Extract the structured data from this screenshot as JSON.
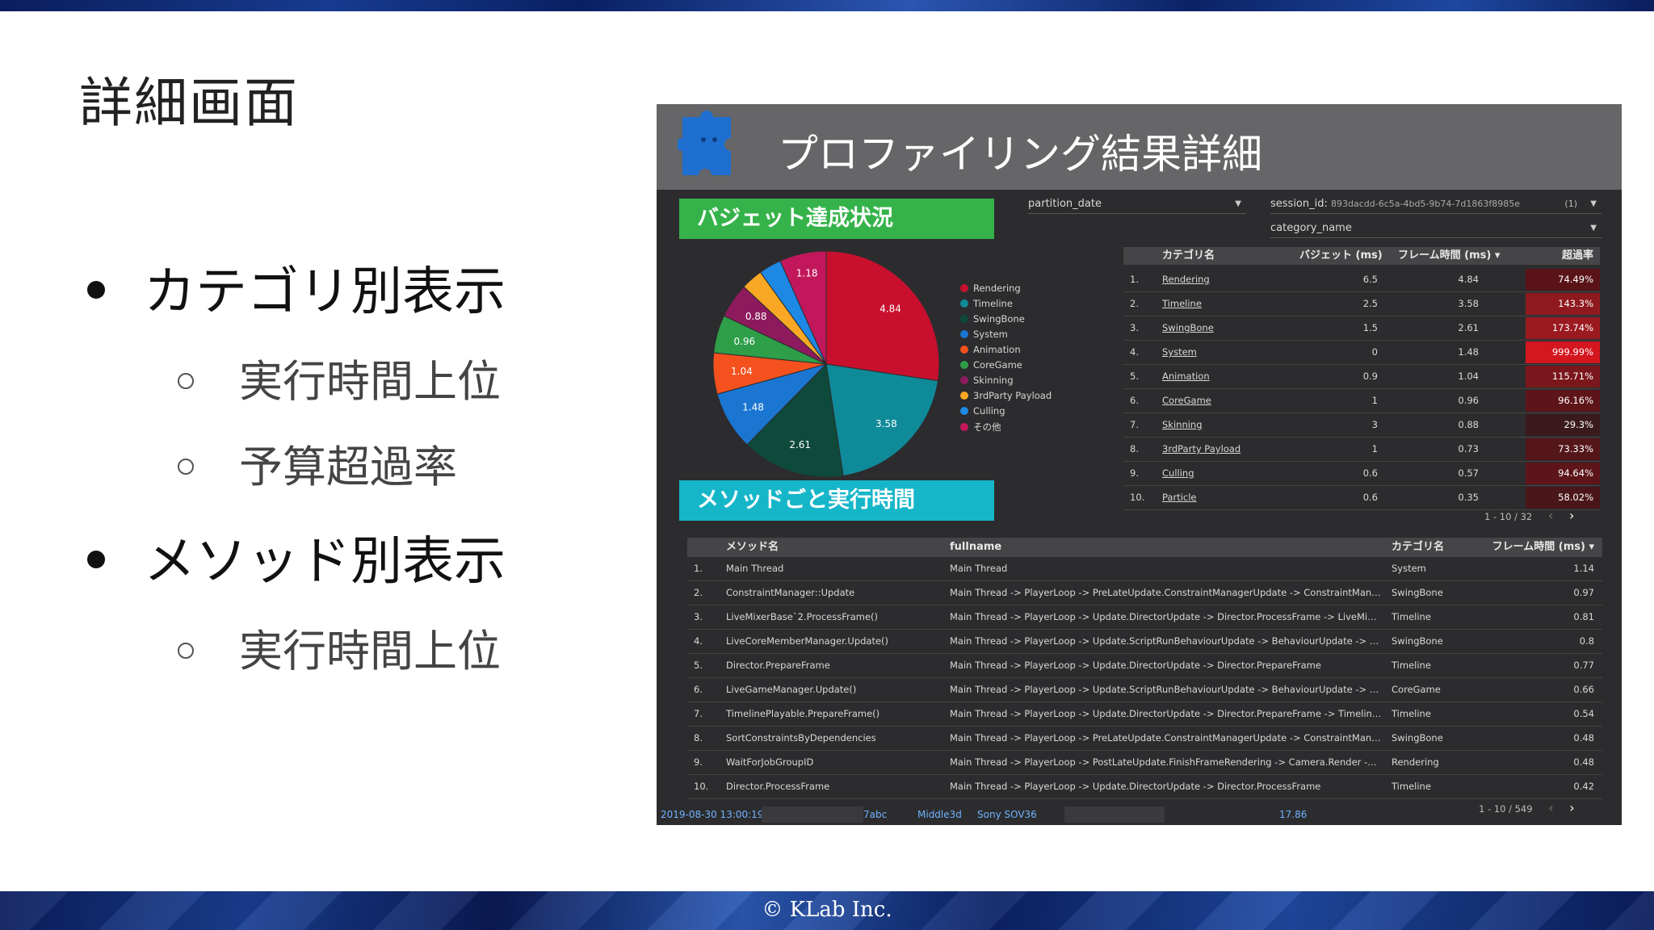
{
  "slide": {
    "title": "詳細画面",
    "bullets": [
      {
        "text": "カテゴリ別表示",
        "sub": [
          "実行時間上位",
          "予算超過率"
        ]
      },
      {
        "text": "メソッド別表示",
        "sub": [
          "実行時間上位"
        ]
      }
    ],
    "copyright": "© KLab Inc."
  },
  "dashboard": {
    "title": "プロファイリング結果詳細",
    "budget_banner": "バジェット達成状況",
    "method_banner": "メソッドごと実行時間",
    "filters": {
      "partition_date": "partition_date",
      "session_label": "session_id:",
      "session_value": "893dacdd-6c5a-4bd5-9b74-7d1863f8985e",
      "session_count": "(1)",
      "category_name": "category_name"
    },
    "category_table": {
      "headers": [
        "カテゴリ名",
        "バジェット (ms)",
        "フレーム時間 (ms) ▾",
        "超過率"
      ],
      "rows": [
        {
          "n": "1.",
          "name": "Rendering",
          "budget": "6.5",
          "frame": "4.84",
          "rate": "74.49%"
        },
        {
          "n": "2.",
          "name": "Timeline",
          "budget": "2.5",
          "frame": "3.58",
          "rate": "143.3%"
        },
        {
          "n": "3.",
          "name": "SwingBone",
          "budget": "1.5",
          "frame": "2.61",
          "rate": "173.74%"
        },
        {
          "n": "4.",
          "name": "System",
          "budget": "0",
          "frame": "1.48",
          "rate": "999.99%"
        },
        {
          "n": "5.",
          "name": "Animation",
          "budget": "0.9",
          "frame": "1.04",
          "rate": "115.71%"
        },
        {
          "n": "6.",
          "name": "CoreGame",
          "budget": "1",
          "frame": "0.96",
          "rate": "96.16%"
        },
        {
          "n": "7.",
          "name": "Skinning",
          "budget": "3",
          "frame": "0.88",
          "rate": "29.3%"
        },
        {
          "n": "8.",
          "name": "3rdParty Payload",
          "budget": "1",
          "frame": "0.73",
          "rate": "73.33%"
        },
        {
          "n": "9.",
          "name": "Culling",
          "budget": "0.6",
          "frame": "0.57",
          "rate": "94.64%"
        },
        {
          "n": "10.",
          "name": "Particle",
          "budget": "0.6",
          "frame": "0.35",
          "rate": "58.02%"
        }
      ],
      "rate_colors": [
        "#5a1418",
        "#8e1a1f",
        "#9b1a20",
        "#d4161f",
        "#7a171c",
        "#5e1519",
        "#3a1a1c",
        "#541619",
        "#5d1519",
        "#4a1619"
      ],
      "pager": "1 - 10 / 32"
    },
    "method_table": {
      "headers": [
        "メソッド名",
        "fullname",
        "カテゴリ名",
        "フレーム時間 (ms) ▾"
      ],
      "rows": [
        {
          "n": "1.",
          "method": "Main Thread",
          "full": "Main Thread",
          "cat": "System",
          "ms": "1.14"
        },
        {
          "n": "2.",
          "method": "ConstraintManager::Update",
          "full": "Main Thread -> PlayerLoop -> PreLateUpdate.ConstraintManagerUpdate -> ConstraintManager::Up...",
          "cat": "SwingBone",
          "ms": "0.97"
        },
        {
          "n": "3.",
          "method": "LiveMixerBase`2.ProcessFrame()",
          "full": "Main Thread -> PlayerLoop -> Update.DirectorUpdate -> Director.ProcessFrame -> LiveMixerBase`2....",
          "cat": "Timeline",
          "ms": "0.81"
        },
        {
          "n": "4.",
          "method": "LiveCoreMemberManager.Update()",
          "full": "Main Thread -> PlayerLoop -> Update.ScriptRunBehaviourUpdate -> BehaviourUpdate -> LiveCoreM...",
          "cat": "SwingBone",
          "ms": "0.8"
        },
        {
          "n": "5.",
          "method": "Director.PrepareFrame",
          "full": "Main Thread -> PlayerLoop -> Update.DirectorUpdate -> Director.PrepareFrame",
          "cat": "Timeline",
          "ms": "0.77"
        },
        {
          "n": "6.",
          "method": "LiveGameManager.Update()",
          "full": "Main Thread -> PlayerLoop -> Update.ScriptRunBehaviourUpdate -> BehaviourUpdate -> LiveGame...",
          "cat": "CoreGame",
          "ms": "0.66"
        },
        {
          "n": "7.",
          "method": "TimelinePlayable.PrepareFrame()",
          "full": "Main Thread -> PlayerLoop -> Update.DirectorUpdate -> Director.PrepareFrame -> TimelinePlayable...",
          "cat": "Timeline",
          "ms": "0.54"
        },
        {
          "n": "8.",
          "method": "SortConstraintsByDependencies",
          "full": "Main Thread -> PlayerLoop -> PreLateUpdate.ConstraintManagerUpdate -> ConstraintManager::Up...",
          "cat": "SwingBone",
          "ms": "0.48"
        },
        {
          "n": "9.",
          "method": "WaitForJobGroupID",
          "full": "Main Thread -> PlayerLoop -> PostLateUpdate.FinishFrameRendering -> Camera.Render -> Culling -...",
          "cat": "Rendering",
          "ms": "0.48"
        },
        {
          "n": "10.",
          "method": "Director.ProcessFrame",
          "full": "Main Thread -> PlayerLoop -> Update.DirectorUpdate -> Director.ProcessFrame",
          "cat": "Timeline",
          "ms": "0.42"
        }
      ],
      "pager": "1 - 10 / 549"
    },
    "statusbar": {
      "date": "2019-08-30 13:00:19",
      "abc": "7abc",
      "mid": "Middle3d",
      "device": "Sony SOV36",
      "value": "17.86"
    }
  },
  "chart_data": {
    "type": "pie",
    "title": "",
    "slices": [
      {
        "label": "Rendering",
        "value": 4.84,
        "color": "#c8102e"
      },
      {
        "label": "Timeline",
        "value": 3.58,
        "color": "#0f8a98"
      },
      {
        "label": "SwingBone",
        "value": 2.61,
        "color": "#0e4a3c"
      },
      {
        "label": "System",
        "value": 1.48,
        "color": "#1b76d2"
      },
      {
        "label": "Animation",
        "value": 1.04,
        "color": "#f4511e"
      },
      {
        "label": "CoreGame",
        "value": 0.96,
        "color": "#2e9e49"
      },
      {
        "label": "Skinning",
        "value": 0.88,
        "color": "#8e1a5e"
      },
      {
        "label": "3rdParty Payload",
        "value": 0.55,
        "color": "#f9a825"
      },
      {
        "label": "Culling",
        "value": 0.57,
        "color": "#1e88e5"
      },
      {
        "label": "その他",
        "value": 1.18,
        "color": "#c2185b"
      }
    ],
    "shown_labels": [
      "4.84",
      "3.58",
      "2.61",
      "1.48",
      "1.04",
      "0.96",
      "0.88",
      "",
      "",
      "1.18"
    ],
    "legend_placement": "right"
  }
}
